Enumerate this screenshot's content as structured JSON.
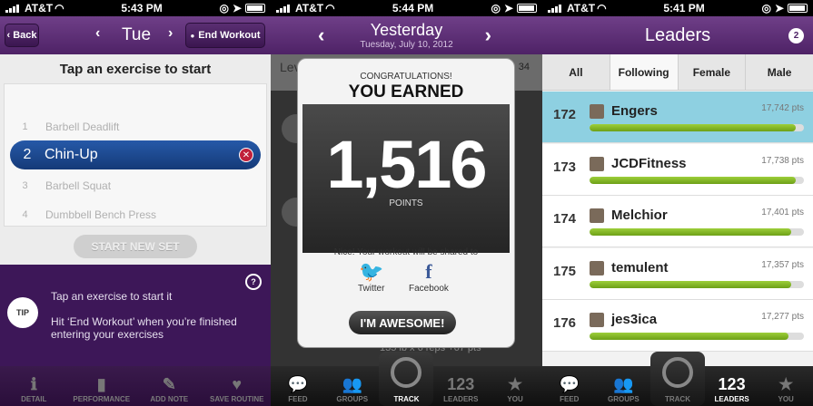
{
  "status": {
    "carrier": "AT&T",
    "times": [
      "5:43 PM",
      "5:44 PM",
      "5:41 PM"
    ]
  },
  "panel1": {
    "nav": {
      "back": "Back",
      "day": "Tue",
      "end_workout": "End Workout"
    },
    "list_title": "Tap an exercise to start",
    "exercises": [
      {
        "num": "1",
        "name": "Barbell Deadlift"
      },
      {
        "num": "2",
        "name": "Chin-Up"
      },
      {
        "num": "3",
        "name": "Barbell Squat"
      },
      {
        "num": "4",
        "name": "Dumbbell Bench Press"
      }
    ],
    "start_new_set": "START NEW SET",
    "tip_badge": "TIP",
    "tip_line1": "Tap an exercise to start it",
    "tip_line2": "Hit ‘End Workout’ when you’re finished entering your exercises",
    "tabs": [
      "DETAIL",
      "PERFORMANCE",
      "ADD NOTE",
      "SAVE ROUTINE"
    ]
  },
  "panel2": {
    "nav": {
      "title": "Yesterday",
      "date": "Tuesday, July 10, 2012"
    },
    "bg_text": {
      "lev": "Lev",
      "num": "34",
      "reps": "135 lb x 6 reps +67 pts"
    },
    "modal": {
      "congrats": "CONGRATULATIONS!",
      "earned": "YOU EARNED",
      "points": "1,516",
      "points_label": "POINTS",
      "share_msg": "Nice! Your workout will be shared to",
      "twitter": "Twitter",
      "facebook": "Facebook",
      "awesome": "I'M AWESOME!"
    },
    "tabs": [
      "FEED",
      "GROUPS",
      "TRACK",
      "LEADERS",
      "YOU"
    ]
  },
  "panel3": {
    "nav": {
      "title": "Leaders",
      "badge": "2"
    },
    "filters": [
      "All",
      "Following",
      "Female",
      "Male"
    ],
    "leaders": [
      {
        "rank": "172",
        "name": "Engers",
        "pts": "17,742 pts",
        "progress": 0.96
      },
      {
        "rank": "173",
        "name": "JCDFitness",
        "pts": "17,738 pts",
        "progress": 0.96
      },
      {
        "rank": "174",
        "name": "Melchior",
        "pts": "17,401 pts",
        "progress": 0.94
      },
      {
        "rank": "175",
        "name": "temulent",
        "pts": "17,357 pts",
        "progress": 0.94
      },
      {
        "rank": "176",
        "name": "jes3ica",
        "pts": "17,277 pts",
        "progress": 0.93
      }
    ],
    "tabs": [
      "FEED",
      "GROUPS",
      "TRACK",
      "LEADERS",
      "YOU"
    ]
  }
}
